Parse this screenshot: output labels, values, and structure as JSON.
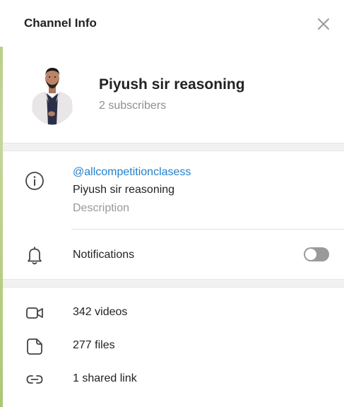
{
  "header": {
    "title": "Channel Info",
    "close_icon": "close-icon"
  },
  "profile": {
    "name": "Piyush sir reasoning",
    "subscribers": "2 subscribers",
    "avatar_icon": "channel-avatar"
  },
  "info": {
    "info_icon": "info-icon",
    "username": "@allcompetitionclasess",
    "bio": "Piyush sir reasoning",
    "description_label": "Description"
  },
  "notifications": {
    "icon": "bell-icon",
    "label": "Notifications",
    "enabled": false
  },
  "media": [
    {
      "icon": "video-icon",
      "label": "342 videos"
    },
    {
      "icon": "file-icon",
      "label": "277 files"
    },
    {
      "icon": "link-icon",
      "label": "1 shared link"
    }
  ],
  "colors": {
    "accent": "#2481cc",
    "text": "#222222",
    "muted": "#8f8f8f",
    "toggle_off": "#9a9a9a"
  }
}
